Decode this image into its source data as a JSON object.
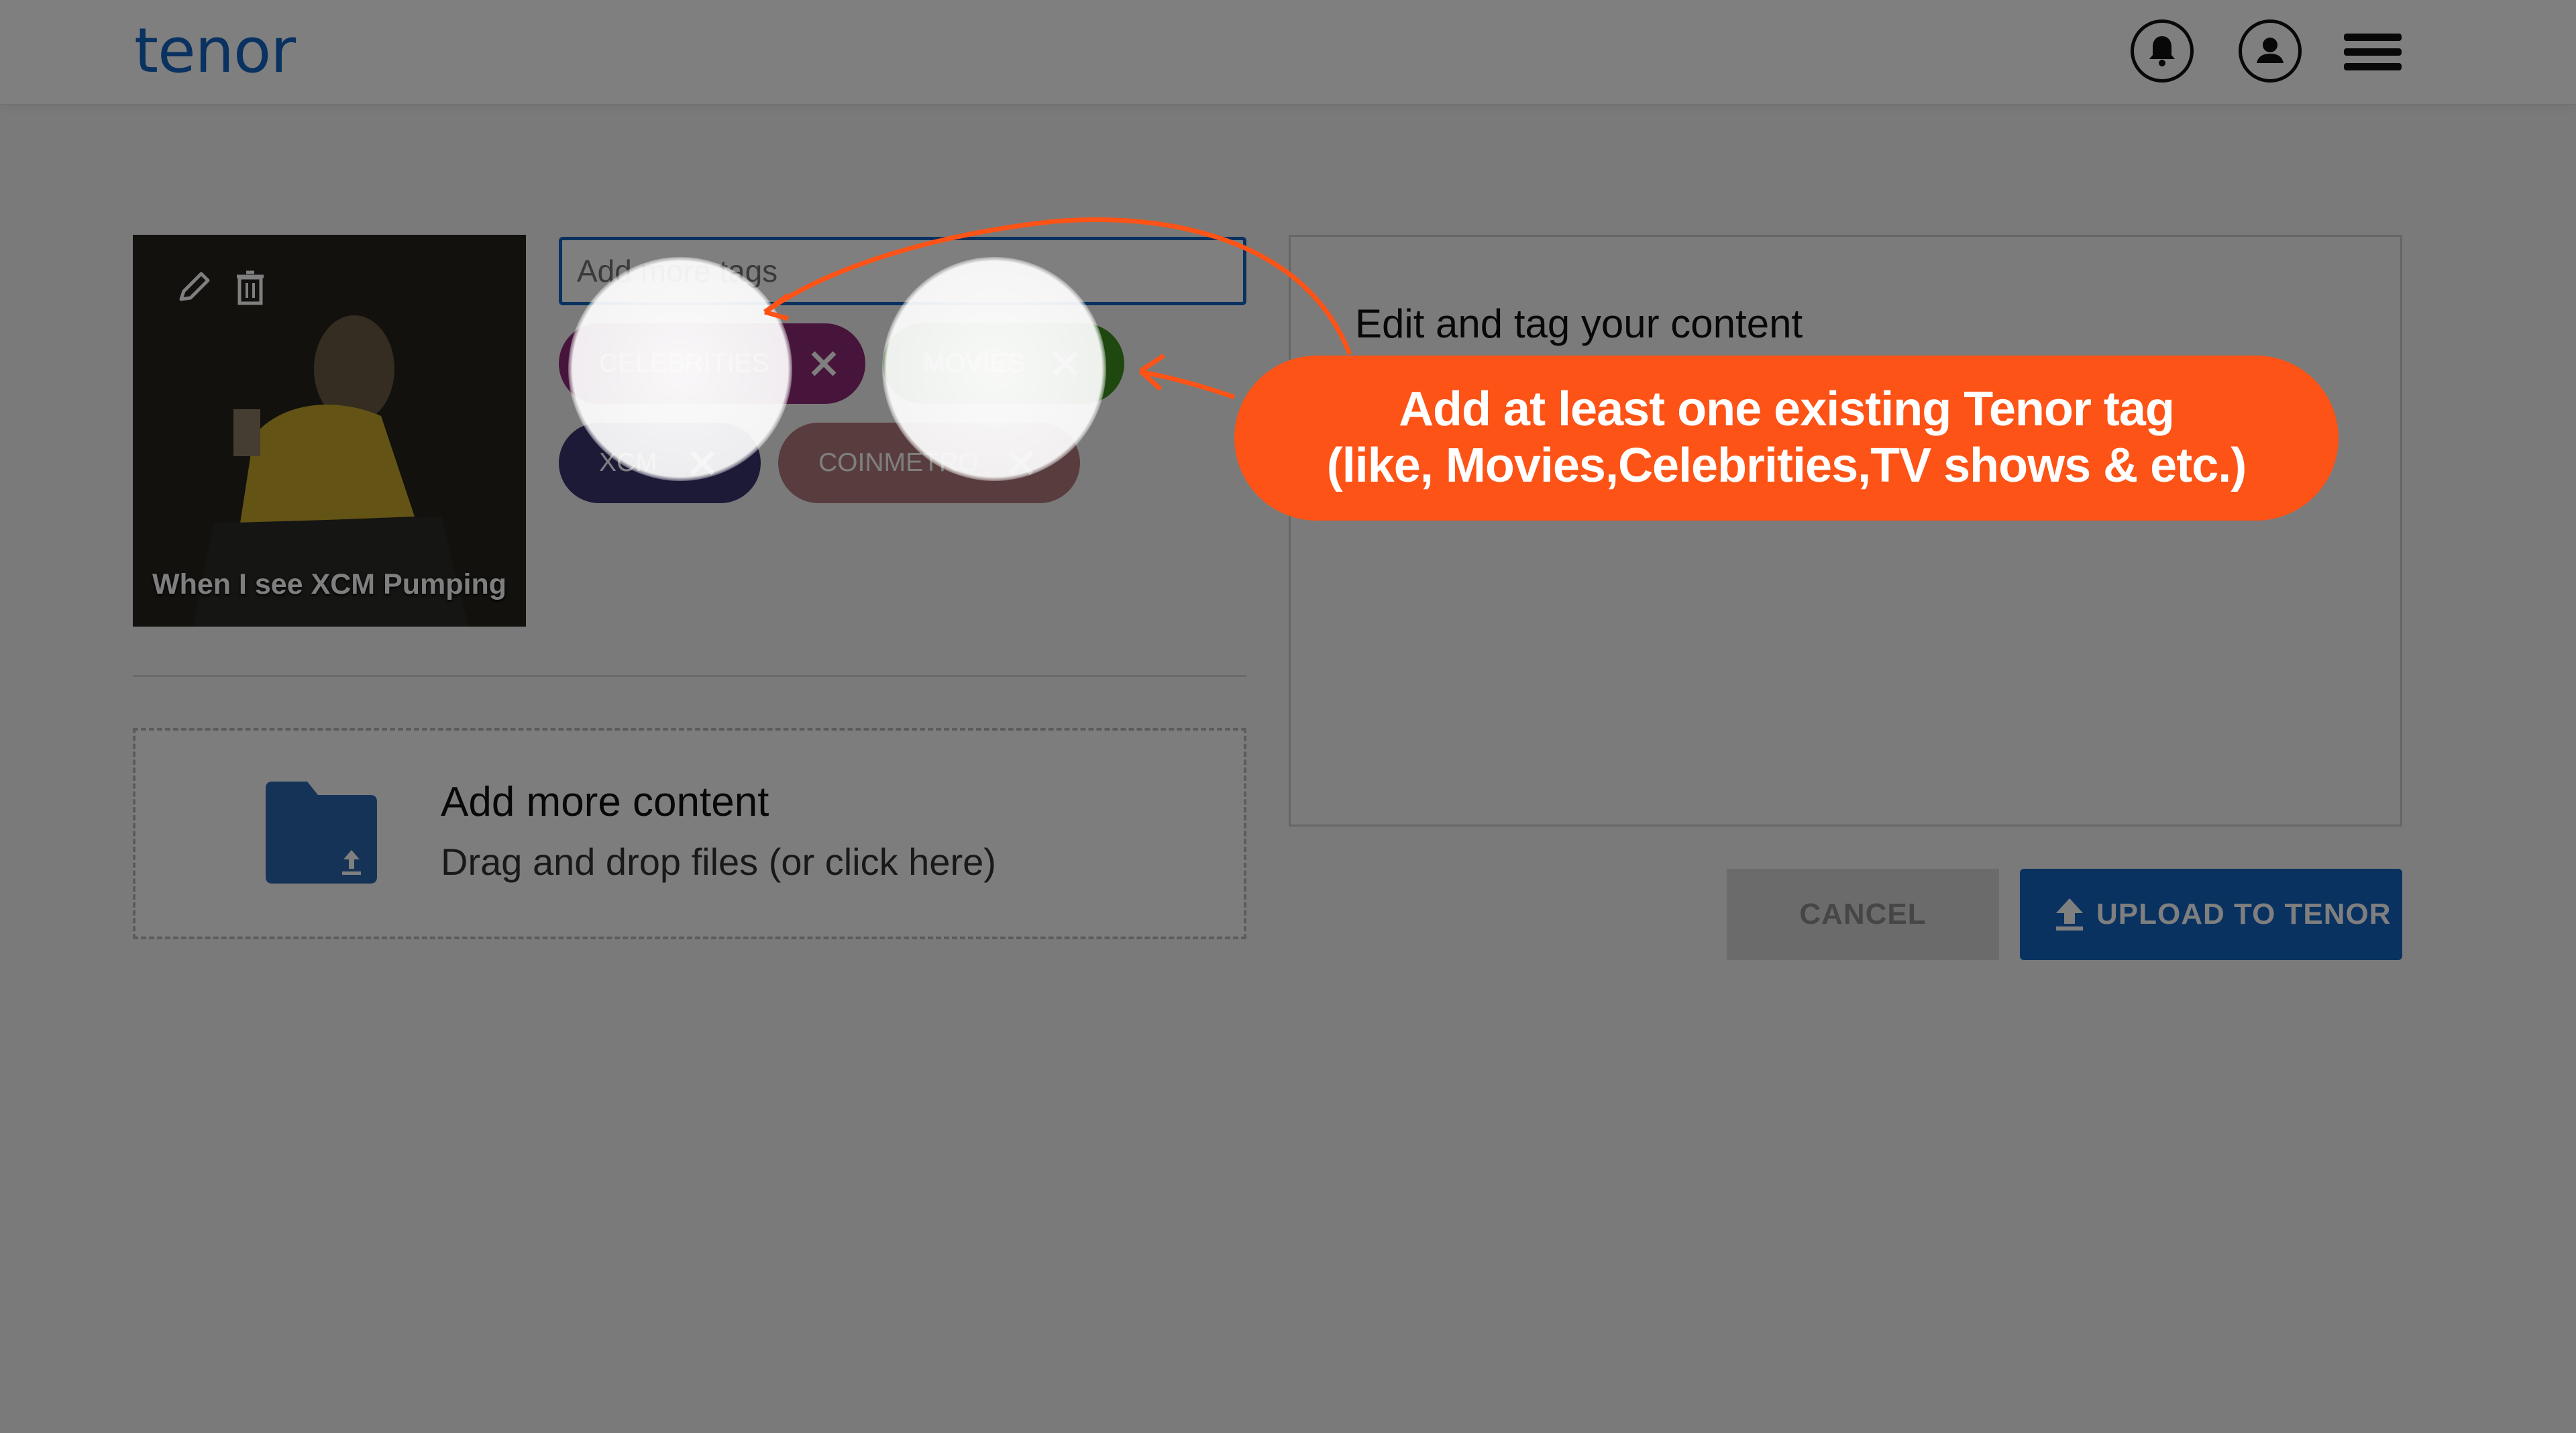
{
  "header": {
    "logo_text": "tenor",
    "icons": [
      "bell-icon",
      "account-icon",
      "menu-icon"
    ]
  },
  "thumbnail": {
    "caption": "When I see XCM Pumping",
    "icons": [
      "pencil-icon",
      "trash-icon"
    ]
  },
  "tags": {
    "input_placeholder": "Add more tags",
    "chips": [
      {
        "label": "CELEBRITIES",
        "color": "#8f2a78"
      },
      {
        "label": "MOVIES",
        "color": "#3e9020"
      },
      {
        "label": "XCM",
        "color": "#38346e"
      },
      {
        "label": "COINMETRO",
        "color": "#b37a7c"
      }
    ]
  },
  "dropzone": {
    "title": "Add more content",
    "subtitle": "Drag and drop files (or click here)",
    "icon": "folder-upload-icon"
  },
  "panel": {
    "title": "Edit and tag your content"
  },
  "actions": {
    "cancel_label": "CANCEL",
    "upload_label": "UPLOAD TO TENOR"
  },
  "callout": {
    "line1": "Add at least one existing Tenor tag",
    "line2": "(like, Movies,Celebrities,TV shows & etc.)",
    "color": "#fd5316"
  }
}
